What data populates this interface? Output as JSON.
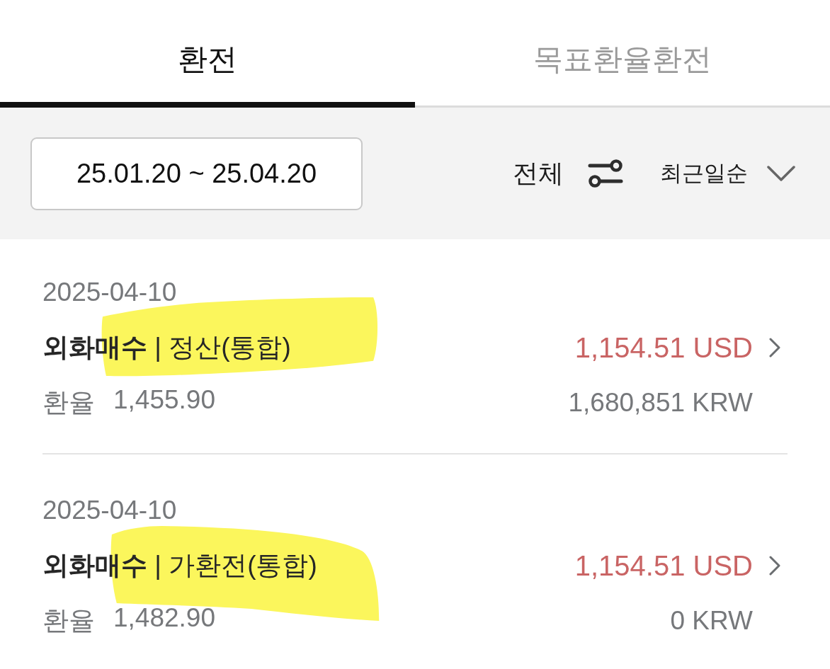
{
  "tabs": [
    {
      "label": "환전",
      "selected": true
    },
    {
      "label": "목표환율환전",
      "selected": false
    }
  ],
  "filter_bar": {
    "date_range": "25.01.20 ~ 25.04.20",
    "filter": "전체",
    "sort": "최근일순"
  },
  "transactions": [
    {
      "date": "2025-04-10",
      "title": "**외화매수** | 정산(통합)",
      "rate_label": "환율",
      "rate": "1,455.90",
      "amount": "1,154.51 USD",
      "krw": "1,680,851 KRW",
      "highlighted": true
    },
    {
      "date": "2025-04-10",
      "title": "**외화매수** | 가환전(통합)",
      "rate_label": "환율",
      "rate": "1,482.90",
      "krw": "0 KRW",
      "amount": "1,154.51 USD",
      "highlighted": true
    }
  ]
}
